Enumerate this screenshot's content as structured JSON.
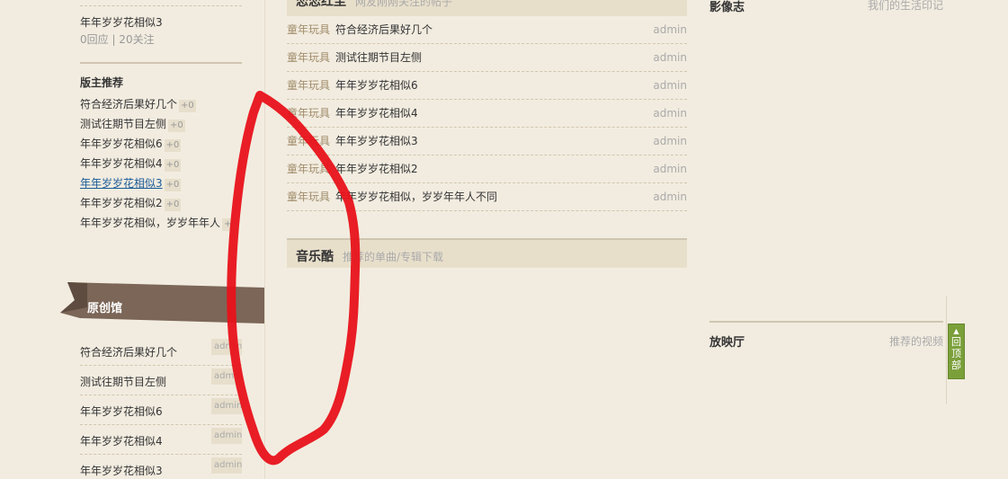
{
  "left": {
    "topic": {
      "title": "年年岁岁花相似3",
      "meta": "0回应 | 20关注"
    },
    "moderator_pick": {
      "title": "版主推荐",
      "items": [
        {
          "label": "符合经济后果好几个",
          "count": "+0"
        },
        {
          "label": "测试往期节目左侧",
          "count": "+0"
        },
        {
          "label": "年年岁岁花相似6",
          "count": "+0"
        },
        {
          "label": "年年岁岁花相似4",
          "count": "+0"
        },
        {
          "label": "年年岁岁花相似3",
          "count": "+0"
        },
        {
          "label": "年年岁岁花相似2",
          "count": "+0"
        },
        {
          "label": "年年岁岁花相似，岁岁年年人",
          "count": "+"
        }
      ]
    },
    "original": {
      "title": "原创馆",
      "items": [
        {
          "label": "符合经济后果好几个",
          "author": "admin"
        },
        {
          "label": "测试往期节目左侧",
          "author": "admin"
        },
        {
          "label": "年年岁岁花相似6",
          "author": "admin"
        },
        {
          "label": "年年岁岁花相似4",
          "author": "admin"
        },
        {
          "label": "年年岁岁花相似3",
          "author": "admin"
        }
      ]
    }
  },
  "middle": {
    "section1": {
      "title": "恋恋红尘",
      "subtitle": "网友刚刚关注的帖子"
    },
    "posts": [
      {
        "category": "童年玩具",
        "title": "符合经济后果好几个",
        "author": "admin"
      },
      {
        "category": "童年玩具",
        "title": "测试往期节目左侧",
        "author": "admin"
      },
      {
        "category": "童年玩具",
        "title": "年年岁岁花相似6",
        "author": "admin"
      },
      {
        "category": "童年玩具",
        "title": "年年岁岁花相似4",
        "author": "admin"
      },
      {
        "category": "童年玩具",
        "title": "年年岁岁花相似3",
        "author": "admin"
      },
      {
        "category": "童年玩具",
        "title": "年年岁岁花相似2",
        "author": "admin"
      },
      {
        "category": "童年玩具",
        "title": "年年岁岁花相似，岁岁年年人不同",
        "author": "admin"
      }
    ],
    "music": {
      "title": "音乐酷",
      "subtitle": "推荐的单曲/专辑下载"
    }
  },
  "right": {
    "section1": {
      "title": "影像志",
      "subtitle": "我们的生活印记"
    },
    "section2": {
      "title": "放映厅",
      "subtitle": "推荐的视频"
    }
  },
  "back_to_top": {
    "arrow": "▲",
    "label": "回顶部"
  },
  "colors": {
    "background": "#f2ece0",
    "header_bg": "#e8dfcb",
    "ribbon": "#7b6657",
    "back_top": "#7ba03a",
    "annotation": "#e8121a"
  }
}
